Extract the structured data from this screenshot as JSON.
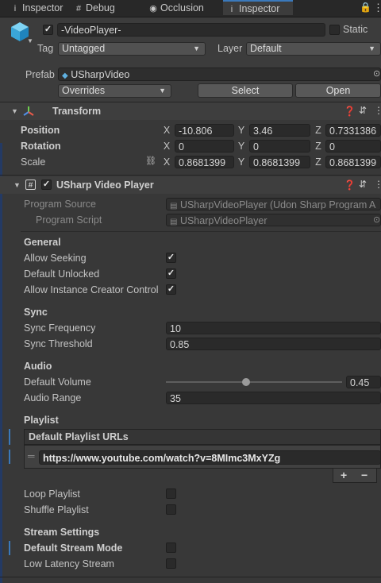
{
  "tabs": [
    {
      "icon": "i",
      "label": "Inspector"
    },
    {
      "icon": "#",
      "label": "Debug"
    },
    {
      "icon": "◉",
      "label": "Occlusion"
    },
    {
      "icon": "i",
      "label": "Inspector"
    }
  ],
  "object": {
    "name": "-VideoPlayer-",
    "static_label": "Static",
    "tag_label": "Tag",
    "tag_value": "Untagged",
    "layer_label": "Layer",
    "layer_value": "Default",
    "prefab_label": "Prefab",
    "prefab_value": "USharpVideo",
    "overrides": "Overrides",
    "select": "Select",
    "open": "Open"
  },
  "transform": {
    "title": "Transform",
    "rows": [
      {
        "label": "Position",
        "x": "-10.806",
        "y": "3.46",
        "z": "0.7331386"
      },
      {
        "label": "Rotation",
        "x": "0",
        "y": "0",
        "z": "0"
      },
      {
        "label": "Scale",
        "x": "0.8681399",
        "y": "0.8681399",
        "z": "0.8681399"
      }
    ],
    "axis": {
      "x": "X",
      "y": "Y",
      "z": "Z"
    }
  },
  "player": {
    "title": "USharp Video Player",
    "program_source_label": "Program Source",
    "program_source_value": "USharpVideoPlayer (Udon Sharp Program A",
    "program_script_label": "Program Script",
    "program_script_value": "USharpVideoPlayer",
    "general": "General",
    "allow_seeking": "Allow Seeking",
    "default_unlocked": "Default Unlocked",
    "allow_instance": "Allow Instance Creator Control",
    "sync": "Sync",
    "sync_frequency_label": "Sync Frequency",
    "sync_frequency": "10",
    "sync_threshold_label": "Sync Threshold",
    "sync_threshold": "0.85",
    "audio": "Audio",
    "default_volume_label": "Default Volume",
    "default_volume": "0.45",
    "audio_range_label": "Audio Range",
    "audio_range": "35",
    "playlist": "Playlist",
    "playlist_urls_label": "Default Playlist URLs",
    "playlist_url": "https://www.youtube.com/watch?v=8MImc3MxYZg",
    "plus": "+",
    "minus": "−",
    "loop_playlist": "Loop Playlist",
    "shuffle_playlist": "Shuffle Playlist",
    "stream_settings": "Stream Settings",
    "default_stream_mode": "Default Stream Mode",
    "low_latency": "Low Latency Stream"
  }
}
